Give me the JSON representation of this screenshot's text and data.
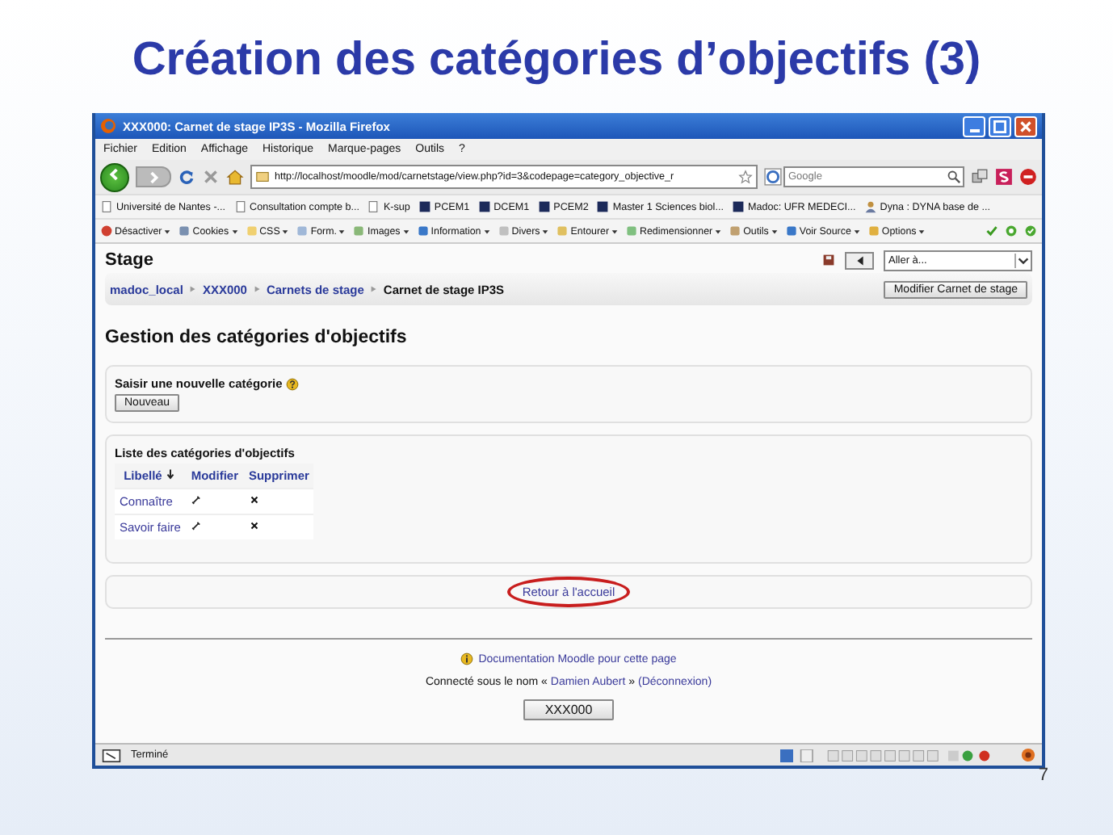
{
  "slide": {
    "title": "Création des catégories d’objectifs (3)",
    "page_number": "7"
  },
  "window": {
    "title": "XXX000: Carnet de stage IP3S - Mozilla Firefox"
  },
  "menu": [
    "Fichier",
    "Edition",
    "Affichage",
    "Historique",
    "Marque-pages",
    "Outils",
    "?"
  ],
  "address": {
    "value": "http://localhost/moodle/mod/carnetstage/view.php?id=3&codepage=category_objective_r"
  },
  "search": {
    "placeholder": "Google"
  },
  "bookmarks": [
    {
      "label": "Université de Nantes -...",
      "kind": "page"
    },
    {
      "label": "Consultation compte b...",
      "kind": "page"
    },
    {
      "label": "K-sup",
      "kind": "page"
    },
    {
      "label": "PCEM1",
      "kind": "site"
    },
    {
      "label": "DCEM1",
      "kind": "site"
    },
    {
      "label": "PCEM2",
      "kind": "site"
    },
    {
      "label": "Master 1 Sciences biol...",
      "kind": "site"
    },
    {
      "label": "Madoc: UFR MEDECI...",
      "kind": "site"
    },
    {
      "label": "Dyna : DYNA base de ...",
      "kind": "user"
    }
  ],
  "dev_toolbar": [
    "Désactiver",
    "Cookies",
    "CSS",
    "Form.",
    "Images",
    "Information",
    "Divers",
    "Entourer",
    "Redimensionner",
    "Outils",
    "Voir Source",
    "Options"
  ],
  "page": {
    "site_title": "Stage",
    "jump": {
      "value": "Aller à..."
    },
    "breadcrumb": [
      {
        "label": "madoc_local",
        "current": false
      },
      {
        "label": "XXX000",
        "current": false
      },
      {
        "label": "Carnets de stage",
        "current": false
      },
      {
        "label": "Carnet de stage IP3S",
        "current": true
      }
    ],
    "edit_button": "Modifier Carnet de stage",
    "heading": "Gestion des catégories d'objectifs",
    "new_category": {
      "label": "Saisir une nouvelle catégorie",
      "button": "Nouveau"
    },
    "list": {
      "title": "Liste des catégories d'objectifs",
      "columns": [
        "Libellé",
        "Modifier",
        "Supprimer"
      ],
      "rows": [
        {
          "label": "Connaître"
        },
        {
          "label": "Savoir faire"
        }
      ]
    },
    "return_link": {
      "label": "Retour à l'accueil",
      "highlighted": true
    },
    "footer": {
      "doc_link": "Documentation Moodle pour cette page",
      "login_prefix": "Connecté sous le nom «",
      "user": "Damien Aubert",
      "login_mid": "»",
      "logout": "(Déconnexion)",
      "course_button": "XXX000"
    }
  },
  "status": {
    "text": "Terminé"
  }
}
